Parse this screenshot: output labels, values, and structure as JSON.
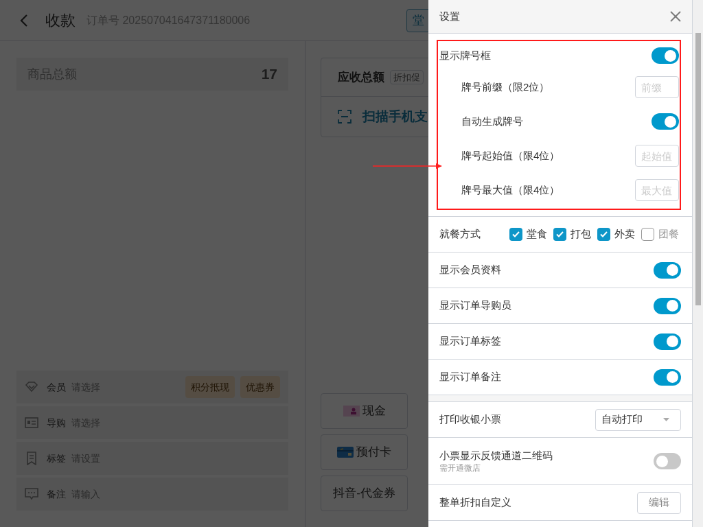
{
  "background": {
    "header": {
      "title": "收款",
      "order_no": "订单号 202507041647371180006",
      "button": "堂"
    },
    "goods_total": {
      "label": "商品总额",
      "value": "17"
    },
    "fields": [
      {
        "kind": "member",
        "label": "会员",
        "placeholder": "请选择",
        "buttons": [
          "积分抵现",
          "优惠券"
        ]
      },
      {
        "kind": "guide",
        "label": "导购",
        "placeholder": "请选择"
      },
      {
        "kind": "tag",
        "label": "标签",
        "placeholder": "请设置"
      },
      {
        "kind": "note",
        "label": "备注",
        "placeholder": "请输入"
      }
    ],
    "receivable": {
      "label": "应收总额",
      "select": "折扣促"
    },
    "scan": {
      "label": "扫描手机支"
    },
    "payments": [
      {
        "kind": "cash",
        "label": "现金"
      },
      {
        "kind": "card",
        "label": "预付卡"
      },
      {
        "kind": "plain",
        "label": "抖音-代金券"
      }
    ]
  },
  "drawer": {
    "title": "设置",
    "sections": [
      [
        {
          "kind": "toggle",
          "label": "显示牌号框",
          "on": true,
          "highlighted": true,
          "children": [
            {
              "kind": "input",
              "label": "牌号前缀（限2位）",
              "placeholder": "前缀"
            },
            {
              "kind": "toggle",
              "label": "自动生成牌号",
              "on": true
            },
            {
              "kind": "input",
              "label": "牌号起始值（限4位）",
              "placeholder": "起始值"
            },
            {
              "kind": "input",
              "label": "牌号最大值（限4位）",
              "placeholder": "最大值"
            }
          ]
        },
        {
          "kind": "checks",
          "label": "就餐方式",
          "options": [
            {
              "label": "堂食",
              "checked": true
            },
            {
              "label": "打包",
              "checked": true
            },
            {
              "label": "外卖",
              "checked": true
            },
            {
              "label": "团餐",
              "checked": false
            }
          ]
        },
        {
          "kind": "toggle",
          "label": "显示会员资料",
          "on": true
        },
        {
          "kind": "toggle",
          "label": "显示订单导购员",
          "on": true
        },
        {
          "kind": "toggle",
          "label": "显示订单标签",
          "on": true
        },
        {
          "kind": "toggle",
          "label": "显示订单备注",
          "on": true
        }
      ],
      [
        {
          "kind": "select",
          "label": "打印收银小票",
          "value": "自动打印"
        },
        {
          "kind": "toggle",
          "label": "小票显示反馈通道二维码",
          "note": "需开通微店",
          "on": false
        },
        {
          "kind": "button",
          "label": "整单折扣自定义",
          "button": "编辑"
        }
      ]
    ]
  }
}
